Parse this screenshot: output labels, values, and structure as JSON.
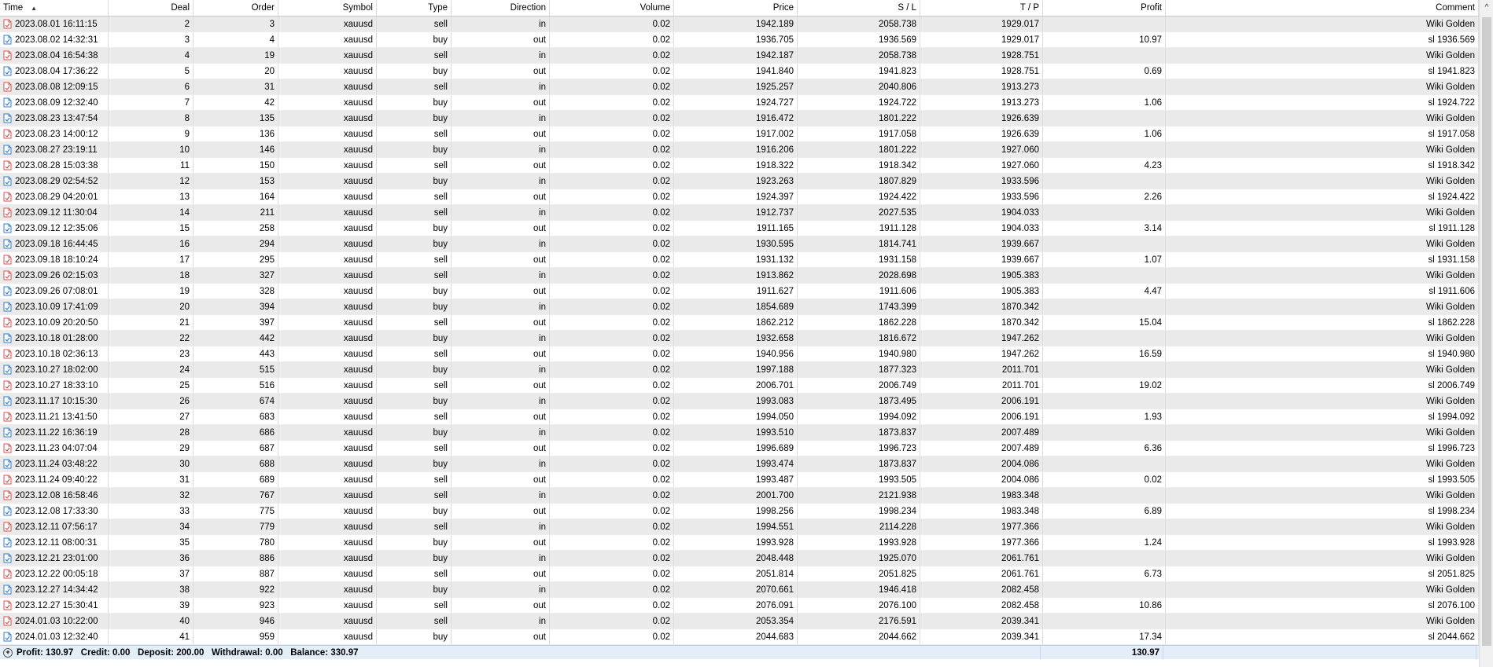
{
  "header": {
    "time": "Time",
    "deal": "Deal",
    "order": "Order",
    "symbol": "Symbol",
    "type": "Type",
    "direction": "Direction",
    "volume": "Volume",
    "price": "Price",
    "sl": "S / L",
    "tp": "T / P",
    "profit": "Profit",
    "comment": "Comment"
  },
  "rows": [
    {
      "time": "2023.08.01 16:11:15",
      "deal": "2",
      "order": "3",
      "symbol": "xauusd",
      "type": "sell",
      "direction": "in",
      "volume": "0.02",
      "price": "1942.189",
      "sl": "2058.738",
      "tp": "1929.017",
      "profit": "",
      "comment": "Wiki Golden"
    },
    {
      "time": "2023.08.02 14:32:31",
      "deal": "3",
      "order": "4",
      "symbol": "xauusd",
      "type": "buy",
      "direction": "out",
      "volume": "0.02",
      "price": "1936.705",
      "sl": "1936.569",
      "tp": "1929.017",
      "profit": "10.97",
      "comment": "sl 1936.569"
    },
    {
      "time": "2023.08.04 16:54:38",
      "deal": "4",
      "order": "19",
      "symbol": "xauusd",
      "type": "sell",
      "direction": "in",
      "volume": "0.02",
      "price": "1942.187",
      "sl": "2058.738",
      "tp": "1928.751",
      "profit": "",
      "comment": "Wiki Golden"
    },
    {
      "time": "2023.08.04 17:36:22",
      "deal": "5",
      "order": "20",
      "symbol": "xauusd",
      "type": "buy",
      "direction": "out",
      "volume": "0.02",
      "price": "1941.840",
      "sl": "1941.823",
      "tp": "1928.751",
      "profit": "0.69",
      "comment": "sl 1941.823"
    },
    {
      "time": "2023.08.08 12:09:15",
      "deal": "6",
      "order": "31",
      "symbol": "xauusd",
      "type": "sell",
      "direction": "in",
      "volume": "0.02",
      "price": "1925.257",
      "sl": "2040.806",
      "tp": "1913.273",
      "profit": "",
      "comment": "Wiki Golden"
    },
    {
      "time": "2023.08.09 12:32:40",
      "deal": "7",
      "order": "42",
      "symbol": "xauusd",
      "type": "buy",
      "direction": "out",
      "volume": "0.02",
      "price": "1924.727",
      "sl": "1924.722",
      "tp": "1913.273",
      "profit": "1.06",
      "comment": "sl 1924.722"
    },
    {
      "time": "2023.08.23 13:47:54",
      "deal": "8",
      "order": "135",
      "symbol": "xauusd",
      "type": "buy",
      "direction": "in",
      "volume": "0.02",
      "price": "1916.472",
      "sl": "1801.222",
      "tp": "1926.639",
      "profit": "",
      "comment": "Wiki Golden"
    },
    {
      "time": "2023.08.23 14:00:12",
      "deal": "9",
      "order": "136",
      "symbol": "xauusd",
      "type": "sell",
      "direction": "out",
      "volume": "0.02",
      "price": "1917.002",
      "sl": "1917.058",
      "tp": "1926.639",
      "profit": "1.06",
      "comment": "sl 1917.058"
    },
    {
      "time": "2023.08.27 23:19:11",
      "deal": "10",
      "order": "146",
      "symbol": "xauusd",
      "type": "buy",
      "direction": "in",
      "volume": "0.02",
      "price": "1916.206",
      "sl": "1801.222",
      "tp": "1927.060",
      "profit": "",
      "comment": "Wiki Golden"
    },
    {
      "time": "2023.08.28 15:03:38",
      "deal": "11",
      "order": "150",
      "symbol": "xauusd",
      "type": "sell",
      "direction": "out",
      "volume": "0.02",
      "price": "1918.322",
      "sl": "1918.342",
      "tp": "1927.060",
      "profit": "4.23",
      "comment": "sl 1918.342"
    },
    {
      "time": "2023.08.29 02:54:52",
      "deal": "12",
      "order": "153",
      "symbol": "xauusd",
      "type": "buy",
      "direction": "in",
      "volume": "0.02",
      "price": "1923.263",
      "sl": "1807.829",
      "tp": "1933.596",
      "profit": "",
      "comment": "Wiki Golden"
    },
    {
      "time": "2023.08.29 04:20:01",
      "deal": "13",
      "order": "164",
      "symbol": "xauusd",
      "type": "sell",
      "direction": "out",
      "volume": "0.02",
      "price": "1924.397",
      "sl": "1924.422",
      "tp": "1933.596",
      "profit": "2.26",
      "comment": "sl 1924.422"
    },
    {
      "time": "2023.09.12 11:30:04",
      "deal": "14",
      "order": "211",
      "symbol": "xauusd",
      "type": "sell",
      "direction": "in",
      "volume": "0.02",
      "price": "1912.737",
      "sl": "2027.535",
      "tp": "1904.033",
      "profit": "",
      "comment": "Wiki Golden"
    },
    {
      "time": "2023.09.12 12:35:06",
      "deal": "15",
      "order": "258",
      "symbol": "xauusd",
      "type": "buy",
      "direction": "out",
      "volume": "0.02",
      "price": "1911.165",
      "sl": "1911.128",
      "tp": "1904.033",
      "profit": "3.14",
      "comment": "sl 1911.128"
    },
    {
      "time": "2023.09.18 16:44:45",
      "deal": "16",
      "order": "294",
      "symbol": "xauusd",
      "type": "buy",
      "direction": "in",
      "volume": "0.02",
      "price": "1930.595",
      "sl": "1814.741",
      "tp": "1939.667",
      "profit": "",
      "comment": "Wiki Golden"
    },
    {
      "time": "2023.09.18 18:10:24",
      "deal": "17",
      "order": "295",
      "symbol": "xauusd",
      "type": "sell",
      "direction": "out",
      "volume": "0.02",
      "price": "1931.132",
      "sl": "1931.158",
      "tp": "1939.667",
      "profit": "1.07",
      "comment": "sl 1931.158"
    },
    {
      "time": "2023.09.26 02:15:03",
      "deal": "18",
      "order": "327",
      "symbol": "xauusd",
      "type": "sell",
      "direction": "in",
      "volume": "0.02",
      "price": "1913.862",
      "sl": "2028.698",
      "tp": "1905.383",
      "profit": "",
      "comment": "Wiki Golden"
    },
    {
      "time": "2023.09.26 07:08:01",
      "deal": "19",
      "order": "328",
      "symbol": "xauusd",
      "type": "buy",
      "direction": "out",
      "volume": "0.02",
      "price": "1911.627",
      "sl": "1911.606",
      "tp": "1905.383",
      "profit": "4.47",
      "comment": "sl 1911.606"
    },
    {
      "time": "2023.10.09 17:41:09",
      "deal": "20",
      "order": "394",
      "symbol": "xauusd",
      "type": "buy",
      "direction": "in",
      "volume": "0.02",
      "price": "1854.689",
      "sl": "1743.399",
      "tp": "1870.342",
      "profit": "",
      "comment": "Wiki Golden"
    },
    {
      "time": "2023.10.09 20:20:50",
      "deal": "21",
      "order": "397",
      "symbol": "xauusd",
      "type": "sell",
      "direction": "out",
      "volume": "0.02",
      "price": "1862.212",
      "sl": "1862.228",
      "tp": "1870.342",
      "profit": "15.04",
      "comment": "sl 1862.228"
    },
    {
      "time": "2023.10.18 01:28:00",
      "deal": "22",
      "order": "442",
      "symbol": "xauusd",
      "type": "buy",
      "direction": "in",
      "volume": "0.02",
      "price": "1932.658",
      "sl": "1816.672",
      "tp": "1947.262",
      "profit": "",
      "comment": "Wiki Golden"
    },
    {
      "time": "2023.10.18 02:36:13",
      "deal": "23",
      "order": "443",
      "symbol": "xauusd",
      "type": "sell",
      "direction": "out",
      "volume": "0.02",
      "price": "1940.956",
      "sl": "1940.980",
      "tp": "1947.262",
      "profit": "16.59",
      "comment": "sl 1940.980"
    },
    {
      "time": "2023.10.27 18:02:00",
      "deal": "24",
      "order": "515",
      "symbol": "xauusd",
      "type": "buy",
      "direction": "in",
      "volume": "0.02",
      "price": "1997.188",
      "sl": "1877.323",
      "tp": "2011.701",
      "profit": "",
      "comment": "Wiki Golden"
    },
    {
      "time": "2023.10.27 18:33:10",
      "deal": "25",
      "order": "516",
      "symbol": "xauusd",
      "type": "sell",
      "direction": "out",
      "volume": "0.02",
      "price": "2006.701",
      "sl": "2006.749",
      "tp": "2011.701",
      "profit": "19.02",
      "comment": "sl 2006.749"
    },
    {
      "time": "2023.11.17 10:15:30",
      "deal": "26",
      "order": "674",
      "symbol": "xauusd",
      "type": "buy",
      "direction": "in",
      "volume": "0.02",
      "price": "1993.083",
      "sl": "1873.495",
      "tp": "2006.191",
      "profit": "",
      "comment": "Wiki Golden"
    },
    {
      "time": "2023.11.21 13:41:50",
      "deal": "27",
      "order": "683",
      "symbol": "xauusd",
      "type": "sell",
      "direction": "out",
      "volume": "0.02",
      "price": "1994.050",
      "sl": "1994.092",
      "tp": "2006.191",
      "profit": "1.93",
      "comment": "sl 1994.092"
    },
    {
      "time": "2023.11.22 16:36:19",
      "deal": "28",
      "order": "686",
      "symbol": "xauusd",
      "type": "buy",
      "direction": "in",
      "volume": "0.02",
      "price": "1993.510",
      "sl": "1873.837",
      "tp": "2007.489",
      "profit": "",
      "comment": "Wiki Golden"
    },
    {
      "time": "2023.11.23 04:07:04",
      "deal": "29",
      "order": "687",
      "symbol": "xauusd",
      "type": "sell",
      "direction": "out",
      "volume": "0.02",
      "price": "1996.689",
      "sl": "1996.723",
      "tp": "2007.489",
      "profit": "6.36",
      "comment": "sl 1996.723"
    },
    {
      "time": "2023.11.24 03:48:22",
      "deal": "30",
      "order": "688",
      "symbol": "xauusd",
      "type": "buy",
      "direction": "in",
      "volume": "0.02",
      "price": "1993.474",
      "sl": "1873.837",
      "tp": "2004.086",
      "profit": "",
      "comment": "Wiki Golden"
    },
    {
      "time": "2023.11.24 09:40:22",
      "deal": "31",
      "order": "689",
      "symbol": "xauusd",
      "type": "sell",
      "direction": "out",
      "volume": "0.02",
      "price": "1993.487",
      "sl": "1993.505",
      "tp": "2004.086",
      "profit": "0.02",
      "comment": "sl 1993.505"
    },
    {
      "time": "2023.12.08 16:58:46",
      "deal": "32",
      "order": "767",
      "symbol": "xauusd",
      "type": "sell",
      "direction": "in",
      "volume": "0.02",
      "price": "2001.700",
      "sl": "2121.938",
      "tp": "1983.348",
      "profit": "",
      "comment": "Wiki Golden"
    },
    {
      "time": "2023.12.08 17:33:30",
      "deal": "33",
      "order": "775",
      "symbol": "xauusd",
      "type": "buy",
      "direction": "out",
      "volume": "0.02",
      "price": "1998.256",
      "sl": "1998.234",
      "tp": "1983.348",
      "profit": "6.89",
      "comment": "sl 1998.234"
    },
    {
      "time": "2023.12.11 07:56:17",
      "deal": "34",
      "order": "779",
      "symbol": "xauusd",
      "type": "sell",
      "direction": "in",
      "volume": "0.02",
      "price": "1994.551",
      "sl": "2114.228",
      "tp": "1977.366",
      "profit": "",
      "comment": "Wiki Golden"
    },
    {
      "time": "2023.12.11 08:00:31",
      "deal": "35",
      "order": "780",
      "symbol": "xauusd",
      "type": "buy",
      "direction": "out",
      "volume": "0.02",
      "price": "1993.928",
      "sl": "1993.928",
      "tp": "1977.366",
      "profit": "1.24",
      "comment": "sl 1993.928"
    },
    {
      "time": "2023.12.21 23:01:00",
      "deal": "36",
      "order": "886",
      "symbol": "xauusd",
      "type": "buy",
      "direction": "in",
      "volume": "0.02",
      "price": "2048.448",
      "sl": "1925.070",
      "tp": "2061.761",
      "profit": "",
      "comment": "Wiki Golden"
    },
    {
      "time": "2023.12.22 00:05:18",
      "deal": "37",
      "order": "887",
      "symbol": "xauusd",
      "type": "sell",
      "direction": "out",
      "volume": "0.02",
      "price": "2051.814",
      "sl": "2051.825",
      "tp": "2061.761",
      "profit": "6.73",
      "comment": "sl 2051.825"
    },
    {
      "time": "2023.12.27 14:34:42",
      "deal": "38",
      "order": "922",
      "symbol": "xauusd",
      "type": "buy",
      "direction": "in",
      "volume": "0.02",
      "price": "2070.661",
      "sl": "1946.418",
      "tp": "2082.458",
      "profit": "",
      "comment": "Wiki Golden"
    },
    {
      "time": "2023.12.27 15:30:41",
      "deal": "39",
      "order": "923",
      "symbol": "xauusd",
      "type": "sell",
      "direction": "out",
      "volume": "0.02",
      "price": "2076.091",
      "sl": "2076.100",
      "tp": "2082.458",
      "profit": "10.86",
      "comment": "sl 2076.100"
    },
    {
      "time": "2024.01.03 10:22:00",
      "deal": "40",
      "order": "946",
      "symbol": "xauusd",
      "type": "sell",
      "direction": "in",
      "volume": "0.02",
      "price": "2053.354",
      "sl": "2176.591",
      "tp": "2039.341",
      "profit": "",
      "comment": "Wiki Golden"
    },
    {
      "time": "2024.01.03 12:32:40",
      "deal": "41",
      "order": "959",
      "symbol": "xauusd",
      "type": "buy",
      "direction": "out",
      "volume": "0.02",
      "price": "2044.683",
      "sl": "2044.662",
      "tp": "2039.341",
      "profit": "17.34",
      "comment": "sl 2044.662"
    }
  ],
  "footer": {
    "summary": "Profit: 130.97   Credit: 0.00   Deposit: 200.00   Withdrawal: 0.00   Balance: 330.97",
    "profit_total": "130.97"
  },
  "colors": {
    "sell_icon": "#d9534f",
    "buy_icon": "#2f7fd0",
    "row_alt": "#eaeaea",
    "footer_bg": "#e3eef9"
  },
  "icons": {
    "sell": "sell-deal-icon",
    "buy": "buy-deal-icon",
    "sort": "sort-ascending-icon",
    "scroll_up": "scroll-up-arrow-icon",
    "expand": "expand-plus-icon"
  }
}
